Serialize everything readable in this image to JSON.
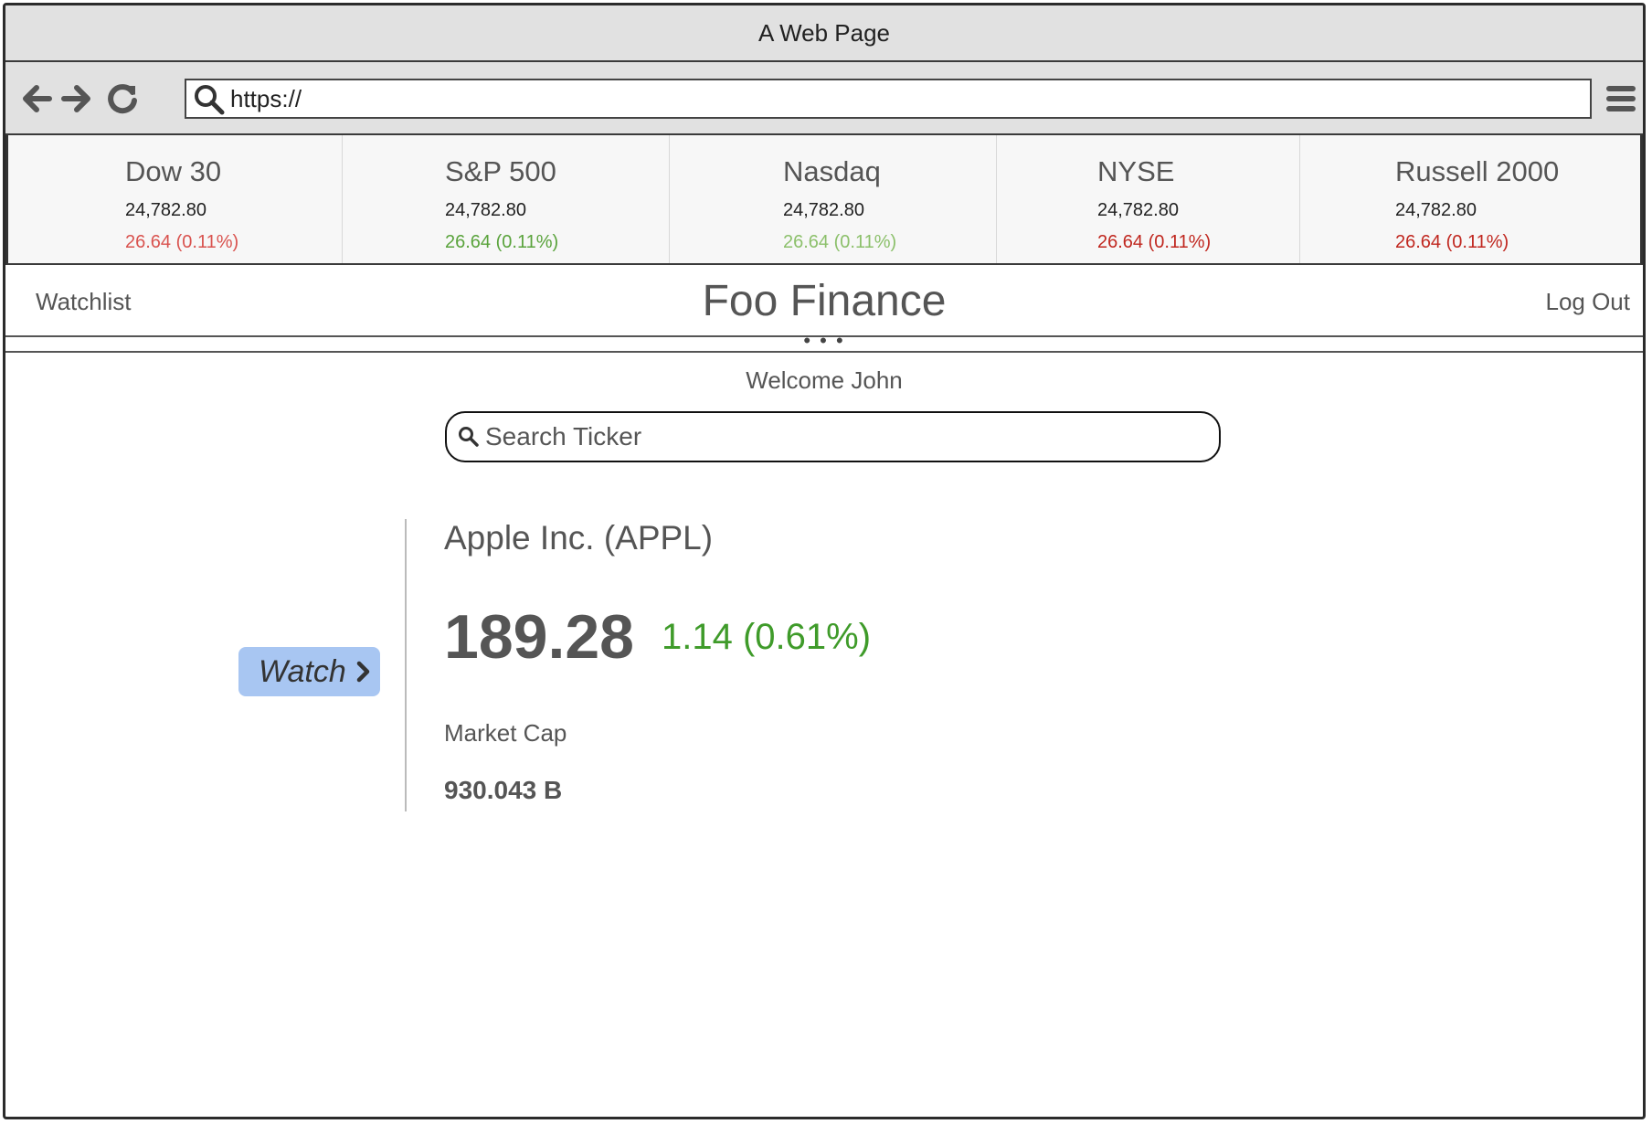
{
  "window": {
    "title": "A Web Page"
  },
  "browser": {
    "url": "https://",
    "back_icon": "arrow-left-icon",
    "forward_icon": "arrow-right-icon",
    "reload_icon": "reload-icon",
    "menu_icon": "hamburger-menu-icon"
  },
  "ticker": [
    {
      "name": "Dow 30",
      "value": "24,782.80",
      "change": "26.64 (0.11%)",
      "color": "#d9534f"
    },
    {
      "name": "S&P 500",
      "value": "24,782.80",
      "change": "26.64 (0.11%)",
      "color": "#5aa33c"
    },
    {
      "name": "Nasdaq",
      "value": "24,782.80",
      "change": "26.64 (0.11%)",
      "color": "#8cc06b"
    },
    {
      "name": "NYSE",
      "value": "24,782.80",
      "change": "26.64 (0.11%)",
      "color": "#c0271f"
    },
    {
      "name": "Russell 2000",
      "value": "24,782.80",
      "change": "26.64 (0.11%)",
      "color": "#c0271f"
    }
  ],
  "header": {
    "watchlist": "Watchlist",
    "brand": "Foo Finance",
    "logout": "Log Out"
  },
  "main": {
    "welcome": "Welcome John",
    "search_placeholder": "Search Ticker",
    "watch_button": "Watch",
    "company": "Apple Inc. (APPL)",
    "price": "189.28",
    "change": "1.14 (0.61%)",
    "change_color": "#3f9b2a",
    "market_cap_label": "Market Cap",
    "market_cap_value": "930.043 B"
  },
  "colors": {
    "watch_button": "#a8c6f2",
    "chrome": "#e1e1e1"
  }
}
